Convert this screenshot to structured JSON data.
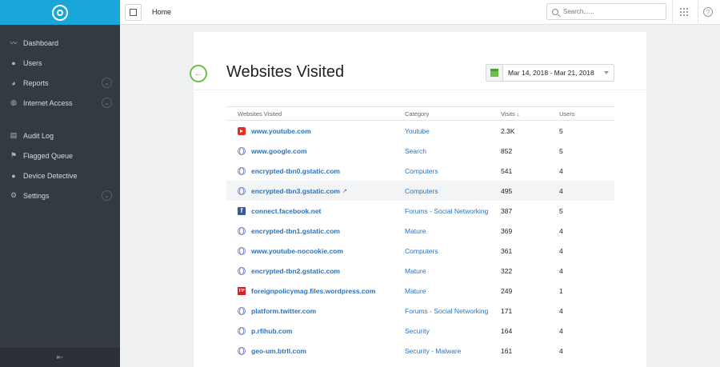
{
  "sidebar": {
    "items": [
      {
        "label": "Dashboard",
        "icon": "chart-line-icon"
      },
      {
        "label": "Users",
        "icon": "user-icon"
      },
      {
        "label": "Reports",
        "icon": "pie-chart-icon"
      },
      {
        "label": "Internet Access",
        "icon": "globe-icon"
      },
      {
        "label": "Audit Log",
        "icon": "list-icon"
      },
      {
        "label": "Flagged Queue",
        "icon": "flag-icon"
      },
      {
        "label": "Device Detective",
        "icon": "user-icon"
      },
      {
        "label": "Settings",
        "icon": "gear-icon"
      }
    ]
  },
  "topbar": {
    "breadcrumb": "Home",
    "search_placeholder": "Search......"
  },
  "page": {
    "title": "Websites Visited",
    "date_range": "Mar 14, 2018 - Mar 21, 2018"
  },
  "table": {
    "headers": {
      "site": "Websites Visited",
      "category": "Category",
      "visits": "Visits ↓",
      "users": "Users"
    },
    "rows": [
      {
        "site": "www.youtube.com",
        "icon": "youtube-icon",
        "category": "Youtube",
        "visits": "2.3K",
        "users": "5"
      },
      {
        "site": "www.google.com",
        "icon": "globe-icon",
        "category": "Search",
        "visits": "852",
        "users": "5"
      },
      {
        "site": "encrypted-tbn0.gstatic.com",
        "icon": "globe-icon",
        "category": "Computers",
        "visits": "541",
        "users": "4"
      },
      {
        "site": "encrypted-tbn3.gstatic.com",
        "icon": "globe-icon",
        "category": "Computers",
        "visits": "495",
        "users": "4"
      },
      {
        "site": "connect.facebook.net",
        "icon": "facebook-icon",
        "category": "Forums - Social Networking",
        "visits": "387",
        "users": "5"
      },
      {
        "site": "encrypted-tbn1.gstatic.com",
        "icon": "globe-icon",
        "category": "Mature",
        "visits": "369",
        "users": "4"
      },
      {
        "site": "www.youtube-nocookie.com",
        "icon": "globe-icon",
        "category": "Computers",
        "visits": "361",
        "users": "4"
      },
      {
        "site": "encrypted-tbn2.gstatic.com",
        "icon": "globe-icon",
        "category": "Mature",
        "visits": "322",
        "users": "4"
      },
      {
        "site": "foreignpolicymag.files.wordpress.com",
        "icon": "fp-icon",
        "category": "Mature",
        "visits": "249",
        "users": "1"
      },
      {
        "site": "platform.twitter.com",
        "icon": "globe-icon",
        "category": "Forums - Social Networking",
        "visits": "171",
        "users": "4"
      },
      {
        "site": "p.rfihub.com",
        "icon": "globe-icon",
        "category": "Security",
        "visits": "164",
        "users": "4"
      },
      {
        "site": "geo-um.btrll.com",
        "icon": "globe-icon",
        "category": "Security - Malware",
        "visits": "161",
        "users": "4"
      }
    ]
  },
  "icon_glyphs": {
    "fb": "f",
    "fp": "FP"
  },
  "colors": {
    "brand": "#19a6d8",
    "sidebar": "#333a41",
    "accent_green": "#6cc04a",
    "link": "#2a73c0"
  }
}
